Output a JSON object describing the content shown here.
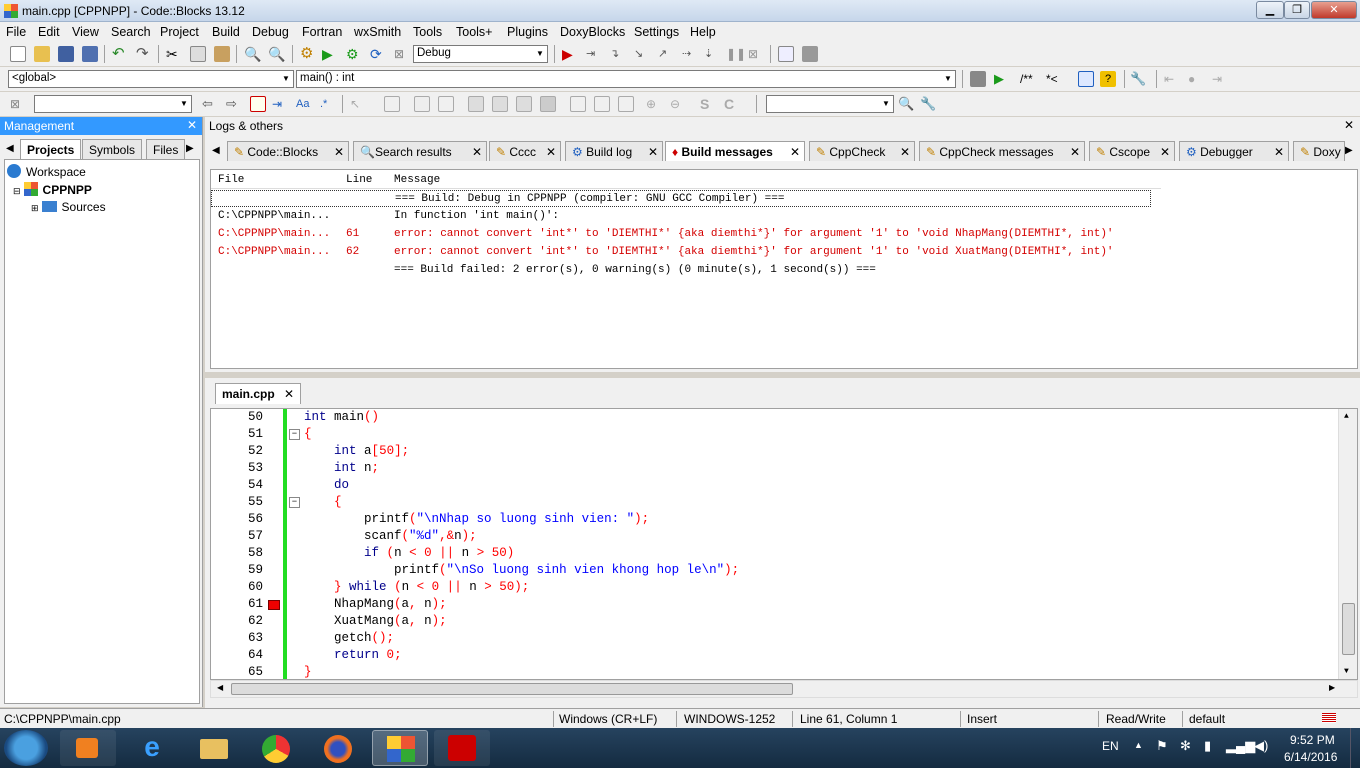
{
  "window": {
    "title": "main.cpp [CPPNPP] - Code::Blocks 13.12",
    "min": "▁",
    "max": "❐",
    "close": "✕"
  },
  "menu": [
    "File",
    "Edit",
    "View",
    "Search",
    "Project",
    "Build",
    "Debug",
    "Fortran",
    "wxSmith",
    "Tools",
    "Tools+",
    "Plugins",
    "DoxyBlocks",
    "Settings",
    "Help"
  ],
  "toolbar": {
    "build_target": "Debug",
    "scope": "<global>",
    "function": "main() : int",
    "comment": "/**",
    "uncomment": "*<"
  },
  "management": {
    "title": "Management",
    "close": "✕",
    "tabs": [
      "Projects",
      "Symbols",
      "Files"
    ],
    "workspace": "Workspace",
    "project": "CPPNPP",
    "folder": "Sources"
  },
  "logs": {
    "title": "Logs & others",
    "close": "✕",
    "tabs": [
      "Code::Blocks",
      "Search results",
      "Cccc",
      "Build log",
      "Build messages",
      "CppCheck",
      "CppCheck messages",
      "Cscope",
      "Debugger",
      "Doxy"
    ],
    "columns": [
      "File",
      "Line",
      "Message"
    ],
    "rows": [
      {
        "file": "",
        "line": "",
        "message": "=== Build: Debug in CPPNPP (compiler: GNU GCC Compiler) ===",
        "type": "info"
      },
      {
        "file": "C:\\CPPNPP\\main...",
        "line": "",
        "message": "In function 'int main()':",
        "type": "info"
      },
      {
        "file": "C:\\CPPNPP\\main...",
        "line": "61",
        "message": "error: cannot convert 'int*' to 'DIEMTHI*' {aka diemthi*}' for argument '1' to 'void NhapMang(DIEMTHI*, int)'",
        "type": "error"
      },
      {
        "file": "C:\\CPPNPP\\main...",
        "line": "62",
        "message": "error: cannot convert 'int*' to 'DIEMTHI*' {aka diemthi*}' for argument '1' to 'void XuatMang(DIEMTHI*, int)'",
        "type": "error"
      },
      {
        "file": "",
        "line": "",
        "message": "=== Build failed: 2 error(s), 0 warning(s) (0 minute(s), 1 second(s)) ===",
        "type": "info"
      }
    ]
  },
  "editor": {
    "tab": "main.cpp",
    "close": "✕",
    "lines": [
      {
        "n": "50",
        "t": "int main()"
      },
      {
        "n": "51",
        "t": "{"
      },
      {
        "n": "52",
        "t": "    int a[50];"
      },
      {
        "n": "53",
        "t": "    int n;"
      },
      {
        "n": "54",
        "t": "    do"
      },
      {
        "n": "55",
        "t": "    {"
      },
      {
        "n": "56",
        "t": "        printf(\"\\nNhap so luong sinh vien: \");"
      },
      {
        "n": "57",
        "t": "        scanf(\"%d\",&n);"
      },
      {
        "n": "58",
        "t": "        if (n < 0 || n > 50)"
      },
      {
        "n": "59",
        "t": "            printf(\"\\nSo luong sinh vien khong hop le\\n\");"
      },
      {
        "n": "60",
        "t": "    } while (n < 0 || n > 50);"
      },
      {
        "n": "61",
        "t": "    NhapMang(a, n);"
      },
      {
        "n": "62",
        "t": "    XuatMang(a, n);"
      },
      {
        "n": "63",
        "t": "    getch();"
      },
      {
        "n": "64",
        "t": "    return 0;"
      },
      {
        "n": "65",
        "t": "}"
      }
    ]
  },
  "status": {
    "path": "C:\\CPPNPP\\main.cpp",
    "eol": "Windows (CR+LF)",
    "encoding": "WINDOWS-1252",
    "position": "Line 61, Column 1",
    "mode": "Insert",
    "access": "Read/Write",
    "lang": "default"
  },
  "tray": {
    "lang": "EN",
    "time": "9:52 PM",
    "date": "6/14/2016"
  },
  "colors": {
    "accent": "#3399ff",
    "error": "#d40000",
    "keyword": "#00008b",
    "string": "#0000ff",
    "number": "#ff0000"
  }
}
